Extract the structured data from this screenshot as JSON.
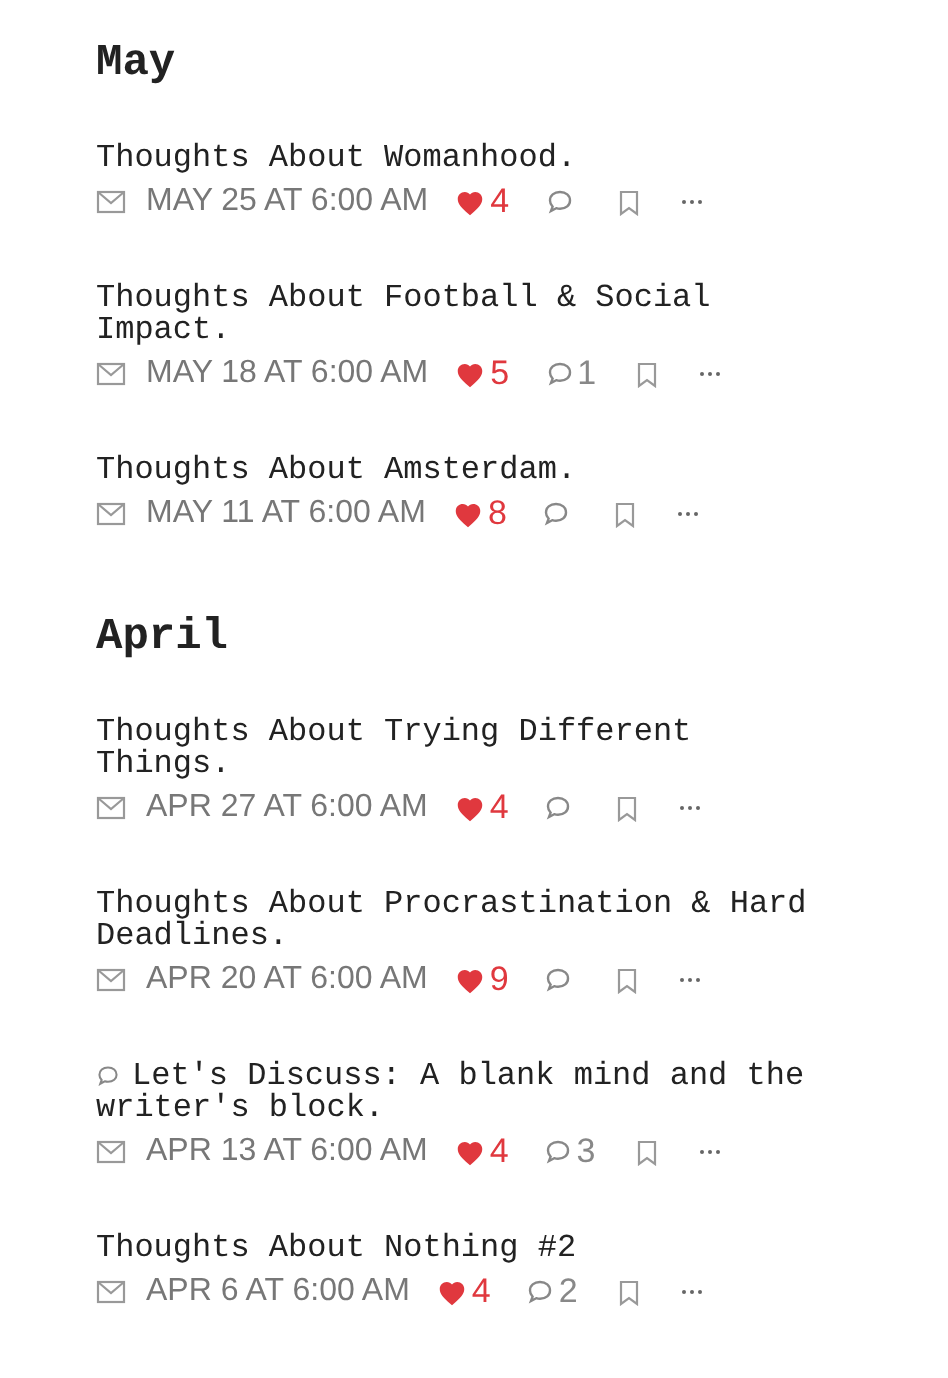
{
  "sections": [
    {
      "heading": "May",
      "posts": [
        {
          "kind": "post",
          "title": "Thoughts About Womanhood.",
          "date": "MAY 25 AT 6:00 AM",
          "likes": "4"
        },
        {
          "kind": "post",
          "title": "Thoughts About Football & Social Impact.",
          "date": "MAY 18 AT 6:00 AM",
          "likes": "5",
          "comments": "1"
        },
        {
          "kind": "post",
          "title": "Thoughts About Amsterdam.",
          "date": "MAY 11 AT 6:00 AM",
          "likes": "8"
        }
      ]
    },
    {
      "heading": "April",
      "posts": [
        {
          "kind": "post",
          "title": "Thoughts About Trying Different Things.",
          "date": "APR 27 AT 6:00 AM",
          "likes": "4"
        },
        {
          "kind": "post",
          "title": "Thoughts About Procrastination & Hard Deadlines.",
          "date": "APR 20 AT 6:00 AM",
          "likes": "9"
        },
        {
          "kind": "discussion",
          "title": "Let's Discuss: A blank mind and the writer's block.",
          "date": "APR 13 AT 6:00 AM",
          "likes": "4",
          "comments": "3"
        },
        {
          "kind": "post",
          "title": "Thoughts About Nothing #2",
          "date": "APR 6 AT 6:00 AM",
          "likes": "4",
          "comments": "2"
        }
      ]
    }
  ]
}
